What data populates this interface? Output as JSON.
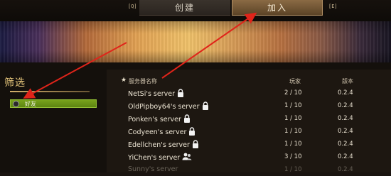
{
  "topbar": {
    "hotkey_left": "[Q]",
    "hotkey_right": "[E]",
    "tab_create": "创建",
    "tab_join": "加入"
  },
  "filter": {
    "title": "筛选",
    "friends_label": "好友"
  },
  "list": {
    "header_name": "服务器名称",
    "header_players": "玩家",
    "header_version": "版本",
    "rows": [
      {
        "name": "NetSi's server",
        "players": "2 / 10",
        "version": "0.2.4",
        "icon": "lock-icon"
      },
      {
        "name": "OldPipboy64's server",
        "players": "1 / 10",
        "version": "0.2.4",
        "icon": "lock-icon"
      },
      {
        "name": "Ponken's server",
        "players": "1 / 10",
        "version": "0.2.4",
        "icon": "lock-icon"
      },
      {
        "name": "Codyeen's server",
        "players": "1 / 10",
        "version": "0.2.4",
        "icon": "lock-icon"
      },
      {
        "name": "Edellchen's server",
        "players": "1 / 10",
        "version": "0.2.4",
        "icon": "lock-icon"
      },
      {
        "name": "YiChen's server",
        "players": "3 / 10",
        "version": "0.2.4",
        "icon": "friends-icon"
      },
      {
        "name": "Sunny's server",
        "players": "1 / 10",
        "version": "0.2.4",
        "icon": ""
      }
    ]
  },
  "colors": {
    "accent_gold": "#e9c97d",
    "friends_green": "#78a31c",
    "arrow_red": "#e0241a"
  }
}
